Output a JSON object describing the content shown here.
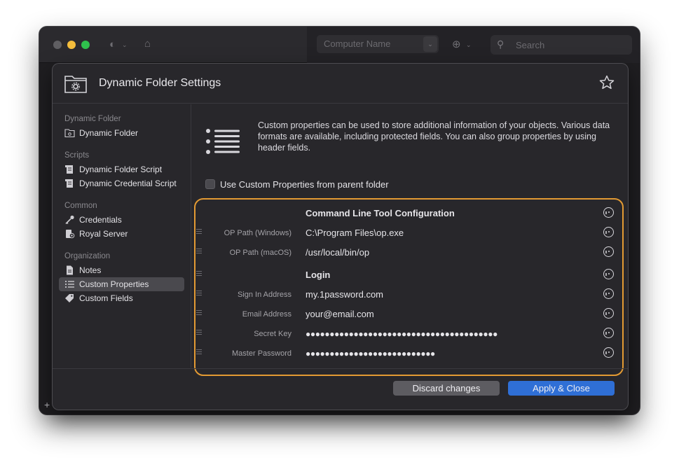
{
  "outer": {
    "computer_name_placeholder": "Computer Name",
    "search_placeholder": "Search",
    "add_symbol": "+"
  },
  "dialog": {
    "title": "Dynamic Folder Settings"
  },
  "sidebar": {
    "sections": [
      {
        "title": "Dynamic Folder",
        "items": [
          {
            "label": "Dynamic Folder",
            "icon": "folder-gear-icon"
          }
        ]
      },
      {
        "title": "Scripts",
        "items": [
          {
            "label": "Dynamic Folder Script",
            "icon": "script-icon"
          },
          {
            "label": "Dynamic Credential Script",
            "icon": "script-icon"
          }
        ]
      },
      {
        "title": "Common",
        "items": [
          {
            "label": "Credentials",
            "icon": "key-icon"
          },
          {
            "label": "Royal Server",
            "icon": "server-icon"
          }
        ]
      },
      {
        "title": "Organization",
        "items": [
          {
            "label": "Notes",
            "icon": "note-icon"
          },
          {
            "label": "Custom Properties",
            "icon": "list-icon",
            "selected": true
          },
          {
            "label": "Custom Fields",
            "icon": "tag-icon"
          }
        ]
      }
    ]
  },
  "content": {
    "description": "Custom properties can be used to store additional information of your objects. Various data formats are available, including protected fields. You can also group properties by using header fields.",
    "inherit_checkbox_label": "Use Custom Properties from parent folder",
    "inherit_checked": false,
    "properties": [
      {
        "label": "",
        "value": "Command Line Tool Configuration",
        "is_header": true
      },
      {
        "label": "OP Path (Windows)",
        "value": "C:\\Program Files\\op.exe"
      },
      {
        "label": "OP Path (macOS)",
        "value": "/usr/local/bin/op"
      },
      {
        "label": "",
        "value": "Login",
        "is_header": true
      },
      {
        "label": "Sign In Address",
        "value": "my.1password.com"
      },
      {
        "label": "Email Address",
        "value": "your@email.com"
      },
      {
        "label": "Secret Key",
        "value": "●●●●●●●●●●●●●●●●●●●●●●●●●●●●●●●●●●●●●●●●",
        "protected": true
      },
      {
        "label": "Master Password",
        "value": "●●●●●●●●●●●●●●●●●●●●●●●●●●●",
        "protected": true
      }
    ]
  },
  "footer": {
    "discard_label": "Discard changes",
    "apply_label": "Apply & Close"
  },
  "colors": {
    "highlight_border": "#e39a33",
    "primary_button": "#2f6fd6",
    "secondary_button": "#5d5c61",
    "dialog_bg": "#28272b"
  }
}
